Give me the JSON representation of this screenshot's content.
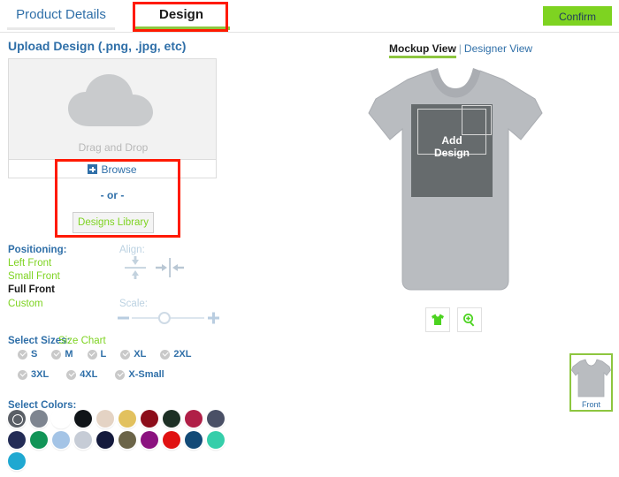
{
  "tabs": {
    "product_details": "Product Details",
    "design": "Design"
  },
  "confirm": {
    "label": "Confirm"
  },
  "upload": {
    "title": "Upload Design (.png, .jpg, etc)",
    "drag_drop": "Drag and Drop",
    "browse": "Browse",
    "or": "- or -",
    "designs_library": "Designs Library"
  },
  "positioning": {
    "label": "Positioning:",
    "options": [
      {
        "label": "Left Front",
        "selected": false
      },
      {
        "label": "Small Front",
        "selected": false
      },
      {
        "label": "Full Front",
        "selected": true
      },
      {
        "label": "Custom",
        "selected": false
      }
    ]
  },
  "align": {
    "label": "Align:",
    "vertical_icon": "align-vertical-center-icon",
    "horizontal_icon": "align-horizontal-center-icon"
  },
  "scale": {
    "label": "Scale:",
    "minus": "-",
    "plus": "+",
    "value_percent": 45
  },
  "sizes": {
    "label": "Select Sizes:",
    "size_chart": "Size Chart",
    "row1": [
      {
        "label": "S",
        "checked": true
      },
      {
        "label": "M",
        "checked": true
      },
      {
        "label": "L",
        "checked": true
      },
      {
        "label": "XL",
        "checked": true
      },
      {
        "label": "2XL",
        "checked": true
      }
    ],
    "row2": [
      {
        "label": "3XL",
        "checked": true
      },
      {
        "label": "4XL",
        "checked": true
      },
      {
        "label": "X-Small",
        "checked": true
      }
    ]
  },
  "colors": {
    "label": "Select Colors:",
    "swatches": [
      {
        "name": "dark-heather",
        "hex": "#5a5f66",
        "selected": true
      },
      {
        "name": "sport-grey",
        "hex": "#7e8590",
        "selected": false
      },
      {
        "name": "white",
        "hex": "#ffffff",
        "selected": false
      },
      {
        "name": "black",
        "hex": "#101418",
        "selected": false
      },
      {
        "name": "natural",
        "hex": "#e4d3c4",
        "selected": false
      },
      {
        "name": "gold",
        "hex": "#e2c15e",
        "selected": false
      },
      {
        "name": "maroon",
        "hex": "#8c0d1a",
        "selected": false
      },
      {
        "name": "forest-green",
        "hex": "#1d3025",
        "selected": false
      },
      {
        "name": "cardinal",
        "hex": "#b01f47",
        "selected": false
      },
      {
        "name": "slate-blue",
        "hex": "#4a5066",
        "selected": false
      },
      {
        "name": "navy",
        "hex": "#232c56",
        "selected": false
      },
      {
        "name": "kelly-green",
        "hex": "#119457",
        "selected": false
      },
      {
        "name": "light-blue",
        "hex": "#a4c4e6",
        "selected": false
      },
      {
        "name": "ash-grey",
        "hex": "#c6ccd6",
        "selected": false
      },
      {
        "name": "midnight-navy",
        "hex": "#141a3c",
        "selected": false
      },
      {
        "name": "military-green",
        "hex": "#6b6448",
        "selected": false
      },
      {
        "name": "purple",
        "hex": "#8b127f",
        "selected": false
      },
      {
        "name": "red",
        "hex": "#e01111",
        "selected": false
      },
      {
        "name": "indigo-blue",
        "hex": "#124a77",
        "selected": false
      },
      {
        "name": "mint",
        "hex": "#35ceaa",
        "selected": false
      },
      {
        "name": "cyan",
        "hex": "#1fa8d1",
        "selected": false
      }
    ]
  },
  "preview": {
    "mockup_view": "Mockup View",
    "separator": "|",
    "designer_view": "Designer View",
    "add_design_line1": "Add",
    "add_design_line2": "Design",
    "tshirt_icon": "tshirt-icon",
    "zoom_icon": "zoom-in-icon",
    "thumbnail_label": "Front"
  },
  "theme": {
    "green": "#7ed321",
    "blue": "#2f6fa8",
    "annotation_red": "#ff1a00",
    "shirt_grey": "#b9bcc0"
  }
}
